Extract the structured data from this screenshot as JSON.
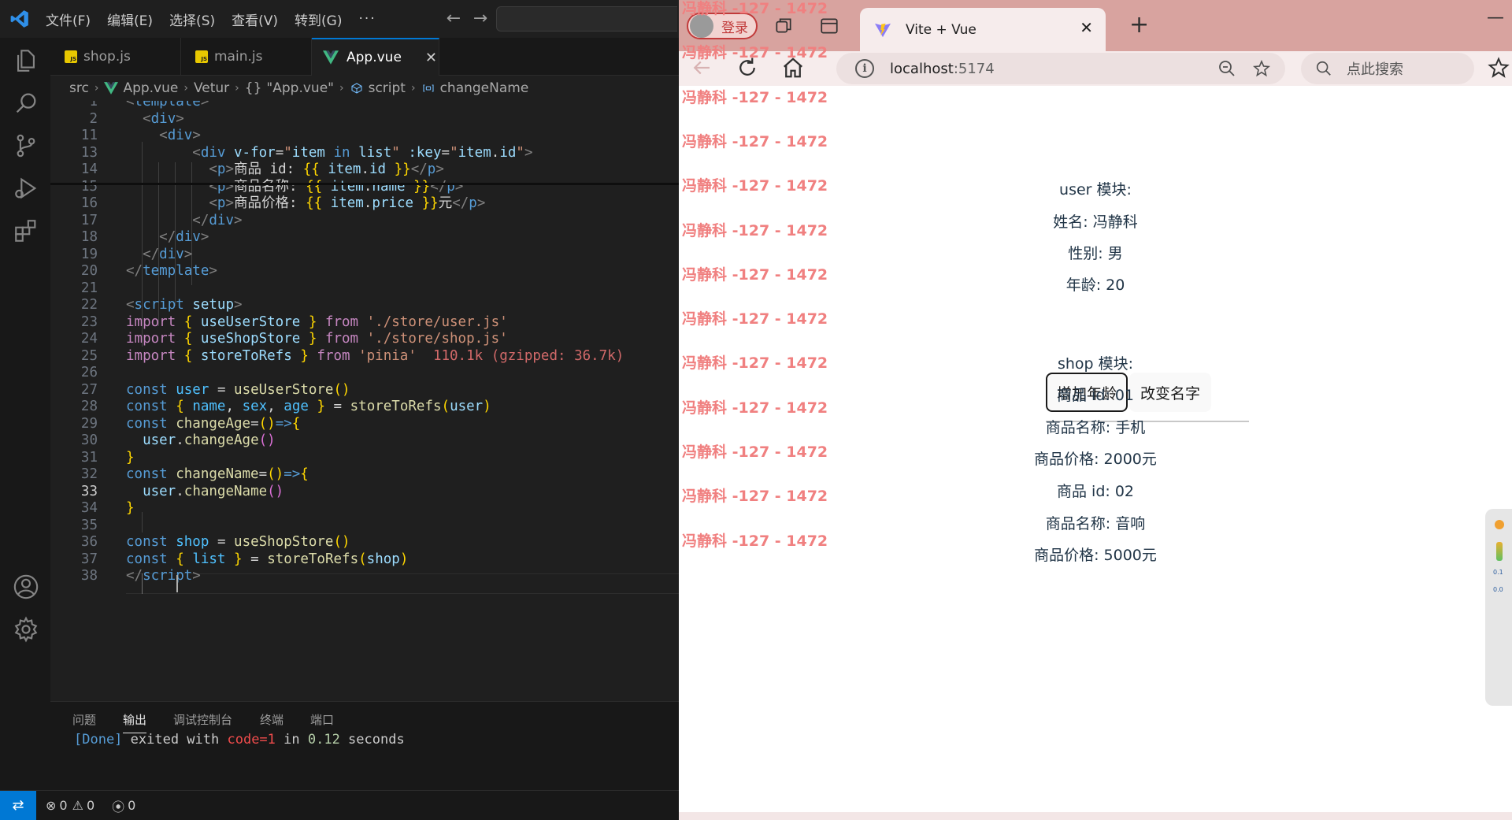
{
  "vscode": {
    "menu": [
      "文件(F)",
      "编辑(E)",
      "选择(S)",
      "查看(V)",
      "转到(G)",
      "···"
    ],
    "tabs": [
      {
        "label": "shop.js",
        "badge": "JS"
      },
      {
        "label": "main.js",
        "badge": "JS"
      },
      {
        "label": "App.vue",
        "badge": "vue"
      }
    ],
    "active_tab_close": "✕",
    "breadcrumb": {
      "src": "src",
      "file": "App.vue",
      "vetur": "Vetur",
      "scope_sym": "{}",
      "scope": "\"App.vue\"",
      "script": "script",
      "symbol": "changeName"
    },
    "line_numbers": [
      "1",
      "2",
      "11",
      "13",
      "14",
      "15",
      "16",
      "17",
      "18",
      "19",
      "20",
      "21",
      "22",
      "23",
      "24",
      "25",
      "26",
      "27",
      "28",
      "29",
      "30",
      "31",
      "32",
      "33",
      "34",
      "35",
      "36",
      "37",
      "38"
    ],
    "current_line": "33",
    "import_size_hint": "110.1k (gzipped: 36.7k)",
    "panel": {
      "tabs": [
        "问题",
        "输出",
        "调试控制台",
        "终端",
        "端口"
      ],
      "active": "输出",
      "output_prefix": "[Done]",
      "output_text": " exited with ",
      "output_code": "code=1",
      "output_suffix": " in ",
      "output_time": "0.12",
      "output_unit": " seconds"
    },
    "status": {
      "errors": "0",
      "warnings": "0",
      "ports": "0"
    }
  },
  "browser": {
    "profile_label": "登录",
    "tab_title": "Vite + Vue",
    "tab_close": "✕",
    "new_tab": "+",
    "minimize": "—",
    "url_host": "localhost",
    "url_port": ":5174",
    "search_placeholder": "点此搜索",
    "watermark": "冯静科 -127 - 1472",
    "user_module": {
      "heading": "user 模块:",
      "name_label": "姓名: 冯静科",
      "sex_label": "性别: 男",
      "age_label": "年龄: 20",
      "btn_age": "增加年龄",
      "btn_name": "改变名字"
    },
    "shop_module": {
      "heading": "shop 模块:",
      "items": [
        {
          "id": "商品 id: 01",
          "name": "商品名称: 手机",
          "price": "商品价格: 2000元"
        },
        {
          "id": "商品 id: 02",
          "name": "商品名称: 音响",
          "price": "商品价格: 5000元"
        }
      ]
    },
    "sidebar_meter": [
      "0.1",
      "0.0"
    ]
  }
}
